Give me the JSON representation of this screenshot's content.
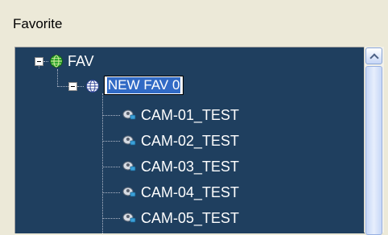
{
  "panel": {
    "title": "Favorite"
  },
  "tree": {
    "root": {
      "label": "FAV",
      "icon": "globe-icon",
      "expanded": true
    },
    "child": {
      "label": "NEW FAV 0",
      "icon": "globe-icon",
      "expanded": true,
      "editing": true
    },
    "cameras": [
      {
        "label": "CAM-01_TEST",
        "icon": "camera-icon"
      },
      {
        "label": "CAM-02_TEST",
        "icon": "camera-icon"
      },
      {
        "label": "CAM-03_TEST",
        "icon": "camera-icon"
      },
      {
        "label": "CAM-04_TEST",
        "icon": "camera-icon"
      },
      {
        "label": "CAM-05_TEST",
        "icon": "camera-icon"
      }
    ]
  },
  "colors": {
    "tree_background": "#1f3f5f",
    "selection": "#316ac5",
    "window_background": "#ece9d8"
  }
}
